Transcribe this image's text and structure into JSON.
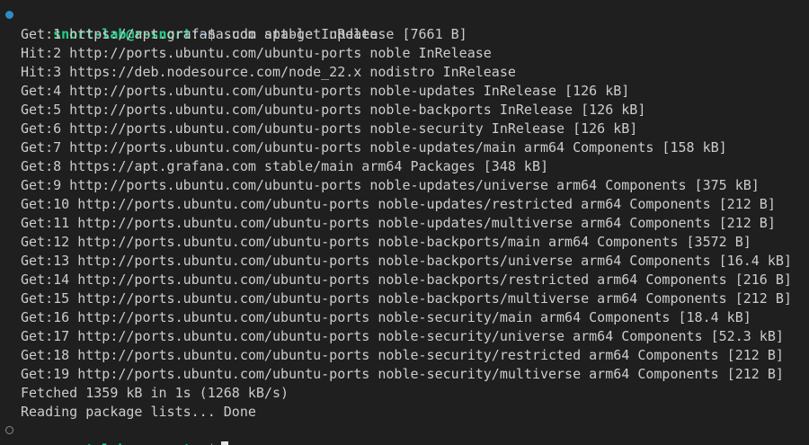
{
  "prompt": {
    "user_host": "snort-lab@r-snort",
    "separator": ":",
    "path": "~",
    "symbol": "$"
  },
  "command": "sudo apt-get update",
  "output_lines": [
    "Get:1 https://apt.grafana.com stable InRelease [7661 B]",
    "Hit:2 http://ports.ubuntu.com/ubuntu-ports noble InRelease",
    "Hit:3 https://deb.nodesource.com/node_22.x nodistro InRelease",
    "Get:4 http://ports.ubuntu.com/ubuntu-ports noble-updates InRelease [126 kB]",
    "Get:5 http://ports.ubuntu.com/ubuntu-ports noble-backports InRelease [126 kB]",
    "Get:6 http://ports.ubuntu.com/ubuntu-ports noble-security InRelease [126 kB]",
    "Get:7 http://ports.ubuntu.com/ubuntu-ports noble-updates/main arm64 Components [158 kB]",
    "Get:8 https://apt.grafana.com stable/main arm64 Packages [348 kB]",
    "Get:9 http://ports.ubuntu.com/ubuntu-ports noble-updates/universe arm64 Components [375 kB]",
    "Get:10 http://ports.ubuntu.com/ubuntu-ports noble-updates/restricted arm64 Components [212 B]",
    "Get:11 http://ports.ubuntu.com/ubuntu-ports noble-updates/multiverse arm64 Components [212 B]",
    "Get:12 http://ports.ubuntu.com/ubuntu-ports noble-backports/main arm64 Components [3572 B]",
    "Get:13 http://ports.ubuntu.com/ubuntu-ports noble-backports/universe arm64 Components [16.4 kB]",
    "Get:14 http://ports.ubuntu.com/ubuntu-ports noble-backports/restricted arm64 Components [216 B]",
    "Get:15 http://ports.ubuntu.com/ubuntu-ports noble-backports/multiverse arm64 Components [212 B]",
    "Get:16 http://ports.ubuntu.com/ubuntu-ports noble-security/main arm64 Components [18.4 kB]",
    "Get:17 http://ports.ubuntu.com/ubuntu-ports noble-security/universe arm64 Components [52.3 kB]",
    "Get:18 http://ports.ubuntu.com/ubuntu-ports noble-security/restricted arm64 Components [212 B]",
    "Get:19 http://ports.ubuntu.com/ubuntu-ports noble-security/multiverse arm64 Components [212 B]",
    "Fetched 1359 kB in 1s (1268 kB/s)",
    "Reading package lists... Done"
  ],
  "colors": {
    "background": "#1f1f1f",
    "text": "#cccccc",
    "prompt_user": "#23d18b",
    "prompt_path": "#3b8eea",
    "decoration_success": "#2e8bc9"
  }
}
